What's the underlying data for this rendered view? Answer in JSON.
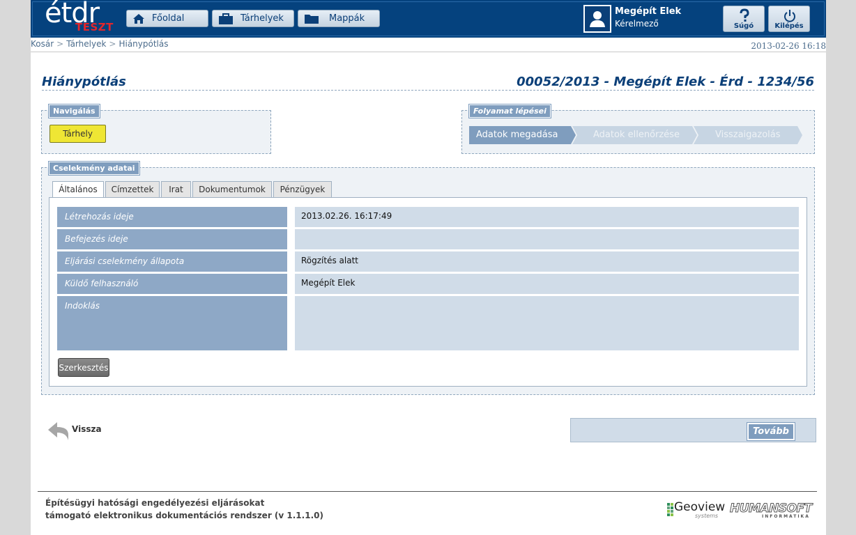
{
  "header": {
    "logo_text": "étdr",
    "logo_badge": "TESZT",
    "nav": [
      {
        "label": "Főoldal",
        "icon": "home-icon"
      },
      {
        "label": "Tárhelyek",
        "icon": "briefcase-icon"
      },
      {
        "label": "Mappák",
        "icon": "folder-icon"
      }
    ],
    "user": {
      "name": "Megépít Elek",
      "role": "Kérelmező",
      "icon": "user-icon"
    },
    "help_label": "Súgó",
    "logout_label": "Kilépés"
  },
  "breadcrumb": [
    "Kosár",
    "Tárhelyek",
    "Hiánypótlás"
  ],
  "datetime": "2013-02-26 16:18",
  "page": {
    "title": "Hiánypótlás",
    "case_title": "00052/2013 - Megépít Elek - Érd - 1234/56"
  },
  "navigation": {
    "legend": "Navigálás",
    "button_label": "Tárhely"
  },
  "process": {
    "legend": "Folyamat lépései",
    "steps": [
      {
        "label": "Adatok megadása",
        "active": true
      },
      {
        "label": "Adatok ellenőrzése",
        "active": false
      },
      {
        "label": "Visszaigazolás",
        "active": false
      }
    ]
  },
  "action": {
    "legend": "Cselekmény adatai",
    "tabs": [
      "Általános",
      "Címzettek",
      "Irat",
      "Dokumentumok",
      "Pénzügyek"
    ],
    "active_tab": "Általános",
    "rows": [
      {
        "label": "Létrehozás ideje",
        "value": "2013.02.26. 16:17:49"
      },
      {
        "label": "Befejezés ideje",
        "value": ""
      },
      {
        "label": "Eljárási cselekmény állapota",
        "value": "Rögzítés alatt"
      },
      {
        "label": "Küldő felhasználó",
        "value": "Megépít Elek"
      },
      {
        "label": "Indoklás",
        "value": ""
      }
    ],
    "edit_label": "Szerkesztés"
  },
  "bottom": {
    "back_label": "Vissza",
    "next_label": "Tovább"
  },
  "footer": {
    "line1": "Építésügyi hatósági engedélyezési eljárásokat",
    "line2": "támogató elektronikus dokumentációs rendszer (v 1.1.1.0)",
    "logo1": "Geoview",
    "logo1_sub": "systems",
    "logo2": "HUMANSOFT",
    "logo2_sub": "INFORMATIKA"
  },
  "colors": {
    "header": "#05427e",
    "accent": "#0b3f78",
    "label_bg": "#8ea8c6",
    "value_bg": "#d0dce8",
    "yellow_button": "#efe634"
  }
}
